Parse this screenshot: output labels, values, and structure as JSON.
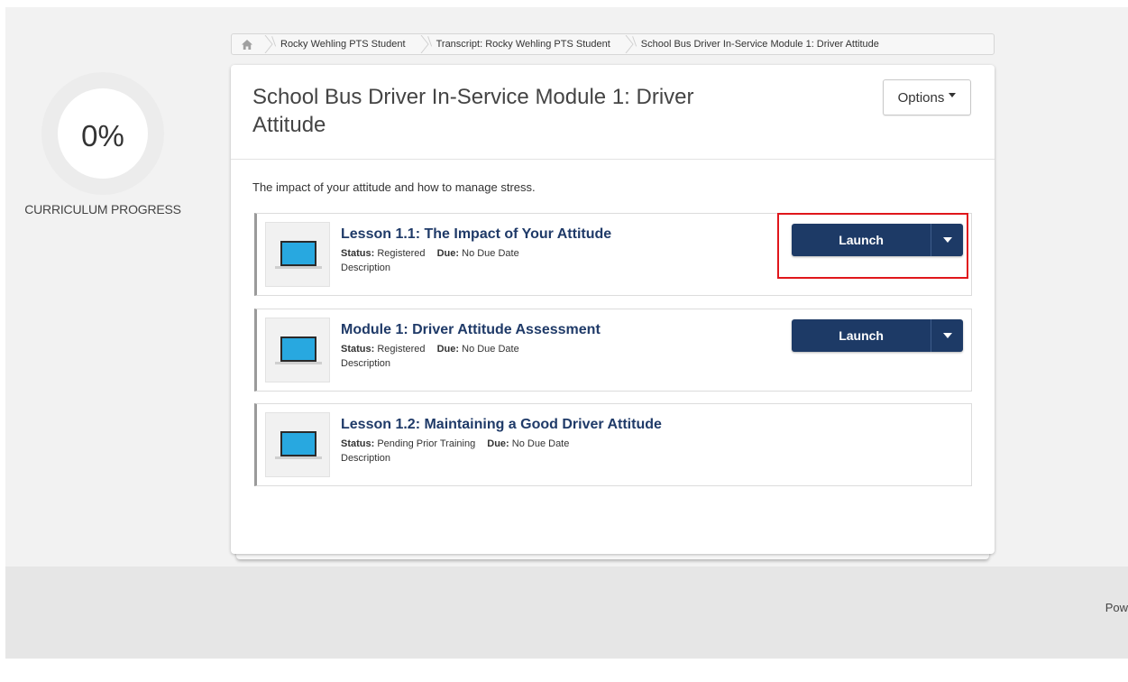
{
  "breadcrumb": {
    "home_icon": "home-icon",
    "items": [
      "Rocky Wehling PTS Student",
      "Transcript: Rocky Wehling PTS Student",
      "School Bus Driver In-Service Module 1: Driver Attitude"
    ]
  },
  "progress": {
    "value": "0%",
    "label": "CURRICULUM PROGRESS"
  },
  "curriculum": {
    "title": "School Bus Driver In-Service Module 1: Driver Attitude",
    "options_label": "Options",
    "description": "The impact of your attitude and how to manage stress."
  },
  "lessons": [
    {
      "title": "Lesson 1.1: The Impact of Your Attitude",
      "status_label": "Status:",
      "status": "Registered",
      "due_label": "Due:",
      "due": "No Due Date",
      "description": "Description",
      "action_label": "Launch"
    },
    {
      "title": "Module 1: Driver Attitude Assessment",
      "status_label": "Status:",
      "status": "Registered",
      "due_label": "Due:",
      "due": "No Due Date",
      "description": "Description",
      "action_label": "Launch"
    },
    {
      "title": "Lesson 1.2: Maintaining a Good Driver Attitude",
      "status_label": "Status:",
      "status": "Pending Prior Training",
      "due_label": "Due:",
      "due": "No Due Date",
      "description": "Description"
    }
  ],
  "footer": {
    "text": "Pow"
  },
  "colors": {
    "launch_button": "#1d3a66",
    "lesson_title": "#1f3a68",
    "highlight": "#e0161b",
    "laptop_screen": "#28a8e0"
  }
}
